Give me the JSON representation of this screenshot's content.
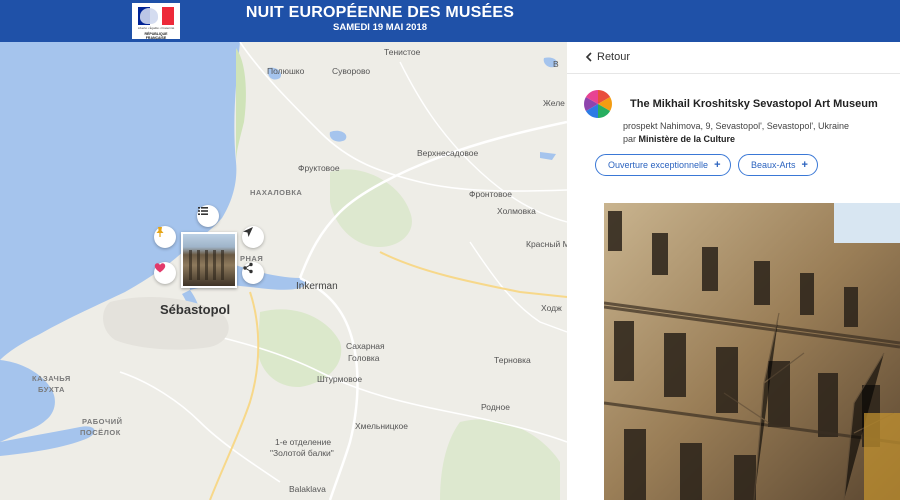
{
  "header": {
    "title": "NUIT EUROPÉENNE DES MUSÉES",
    "subtitle": "SAMEDI 19 MAI 2018",
    "logo": {
      "motto": "Liberté • Égalité • Fraternité",
      "label": "RÉPUBLIQUE FRANÇAISE",
      "colors": [
        "#002395",
        "#ffffff",
        "#ed2939"
      ]
    }
  },
  "map": {
    "labels": {
      "tenistove": "Тенистое",
      "polyushko": "Полюшко",
      "suvorovo": "Суворово",
      "zhel": "Желе",
      "v": "В",
      "verkhnesadovoe": "Верхнесадовое",
      "fruktovoe": "Фруктовое",
      "nakhalovka": "НАХАЛОВКА",
      "frontovoe": "Фронтовое",
      "kholmovka": "Холмовка",
      "krasny_m": "Красный М",
      "rnaya": "РНАЯ",
      "inkerman": "Inkerman",
      "sebastopol": "Sébastopol",
      "khozh": "Ходж",
      "sakharnaya": "Сахарная",
      "golovka": "Головка",
      "shturmovoe": "Штурмовое",
      "ternovka": "Терновка",
      "kazachya": "КАЗАЧЬЯ",
      "bukhta": "БУХТА",
      "rabochiy": "РАБОЧИЙ",
      "posyolok": "ПОСЁЛОК",
      "rodnoe": "Родное",
      "khmelnitskoe": "Хмельницкое",
      "otdelenie": "1-е отделение",
      "zolotoy": "\"Золотой балки\"",
      "balaklava": "Balaklava"
    },
    "marker_buttons": [
      "list-icon",
      "pin-icon",
      "navigate-icon",
      "heart-icon",
      "share-icon"
    ],
    "accent": "#e23a6b"
  },
  "panel": {
    "back_label": "Retour",
    "museum_name": "The Mikhail Kroshitsky Sevastopol Art Museum",
    "address": "prospekt Nahimova, 9, Sevastopol', Sevastopol', Ukraine",
    "by_label": "par",
    "organizer": "Ministère de la Culture",
    "tags": [
      "Ouverture exceptionnelle",
      "Beaux-Arts"
    ],
    "tag_plus": "+",
    "tag_color": "#3a78d6"
  }
}
